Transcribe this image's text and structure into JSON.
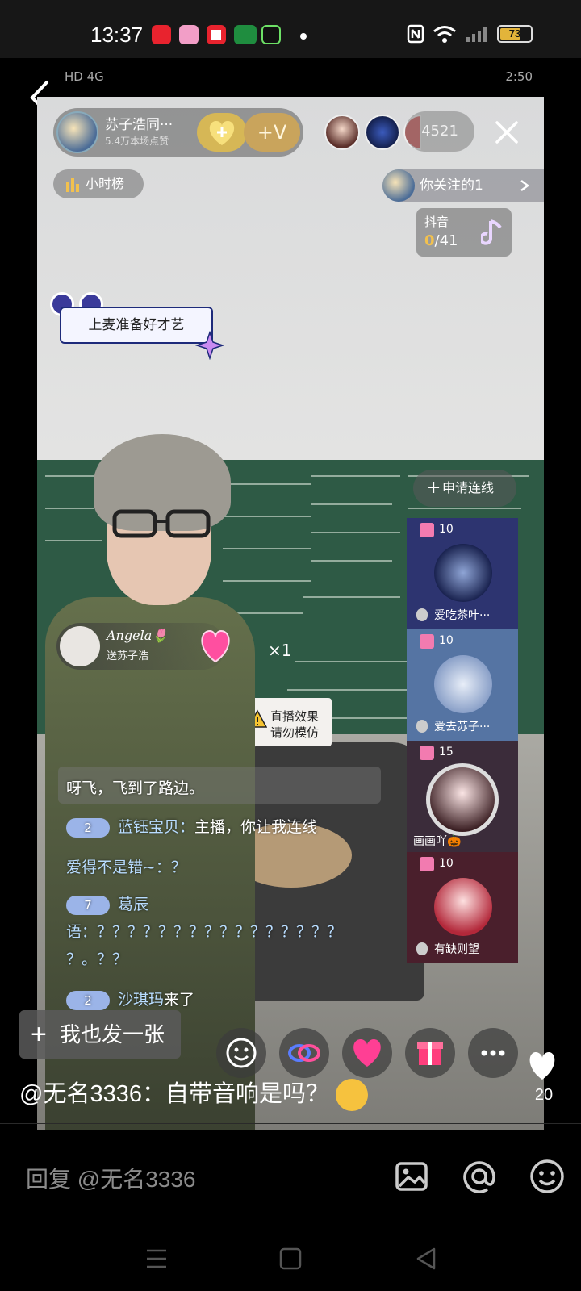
{
  "status_bar": {
    "time": "13:37",
    "battery": "73",
    "battery_level_pct": 73,
    "apps": [
      "youtube-icon",
      "game-app-icon",
      "video-app-icon",
      "oppo-app-icon",
      "music-app-icon"
    ]
  },
  "inner_status": {
    "left": "HD 4G",
    "time": "2:50"
  },
  "live": {
    "host_name": "苏子浩同···",
    "host_sub": "5.4万本场点赞",
    "vip_label": "+V",
    "viewer_count": "4521",
    "rank_label": "小时榜",
    "follow_label": "你关注的1",
    "music": {
      "title": "抖音",
      "count_now": "0",
      "count_total": "/41"
    },
    "bubble_text": "上麦准备好才艺",
    "warning_line1": "直播效果",
    "warning_line2": "请勿模仿",
    "apply_label": "申请连线",
    "mic_slots": [
      {
        "gift": "10",
        "name": "爱吃茶叶···"
      },
      {
        "gift": "10",
        "name": "爱去苏子···"
      },
      {
        "gift": "15",
        "name": "画画吖🎃"
      },
      {
        "gift": "10",
        "name": "有缺则望"
      }
    ],
    "gift_banner": {
      "name": "Angela🌷",
      "sub": "送苏子浩",
      "times": "×1"
    },
    "chat": [
      {
        "text": "呀飞，飞到了路边。"
      },
      {
        "level": "2",
        "user": "蓝钰宝贝：",
        "text": "主播，你让我连线"
      },
      {
        "text": "爱得不是错~：？"
      },
      {
        "level": "7",
        "user": "葛辰",
        "text": ""
      },
      {
        "text": "语：？？？？？？？？？？？？？？？？"
      },
      {
        "text": "？。？？"
      },
      {
        "level": "2",
        "user": "沙琪玛",
        "text": "来了"
      }
    ],
    "post_button": "我也发一张"
  },
  "comment": {
    "text": "@无名3336：自带音响是吗？",
    "likes": "20"
  },
  "reply": {
    "placeholder": "回复 @无名3336"
  },
  "colors": {
    "accent_gold": "#f2c14e",
    "status_bg": "#171717"
  }
}
